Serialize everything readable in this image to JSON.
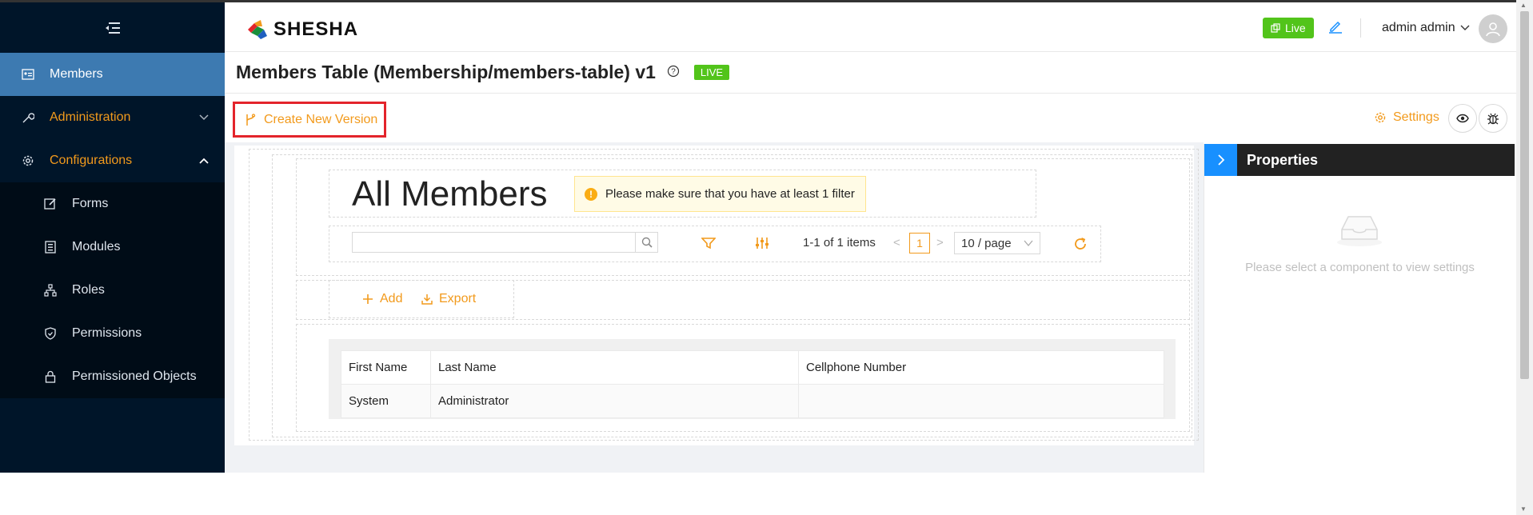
{
  "sidebar": {
    "items": [
      {
        "label": "Members",
        "icon": "id-card-icon"
      },
      {
        "label": "Administration",
        "icon": "wrench-icon"
      },
      {
        "label": "Configurations",
        "icon": "gear-icon"
      }
    ],
    "submenu": [
      {
        "label": "Forms",
        "icon": "edit-form-icon"
      },
      {
        "label": "Modules",
        "icon": "modules-icon"
      },
      {
        "label": "Roles",
        "icon": "roles-icon"
      },
      {
        "label": "Permissions",
        "icon": "shield-icon"
      },
      {
        "label": "Permissioned Objects",
        "icon": "lock-icon"
      }
    ]
  },
  "header": {
    "brand": "SHESHA",
    "live_label": "Live",
    "user_name": "admin admin"
  },
  "page": {
    "title": "Members Table (Membership/members-table) v1",
    "status_tag": "LIVE"
  },
  "toolbar": {
    "create_version_label": "Create New Version",
    "settings_label": "Settings"
  },
  "designer": {
    "heading": "All Members",
    "filter_warning": "Please make sure that you have at least 1 filter",
    "search": {
      "value": "",
      "placeholder": ""
    },
    "pager_text": "1-1 of 1 items",
    "current_page": "1",
    "page_size": "10 / page",
    "add_label": "Add",
    "export_label": "Export",
    "table": {
      "columns": [
        "First Name",
        "Last Name",
        "Cellphone Number"
      ],
      "rows": [
        [
          "System",
          "Administrator",
          ""
        ]
      ]
    }
  },
  "properties": {
    "title": "Properties",
    "empty_text": "Please select a component to view settings"
  },
  "colors": {
    "accent": "#f29a1c",
    "sidebar_bg": "#001529",
    "active_item": "#3d7ab1",
    "live_green": "#52c41a",
    "highlight_border": "#e3242b"
  }
}
